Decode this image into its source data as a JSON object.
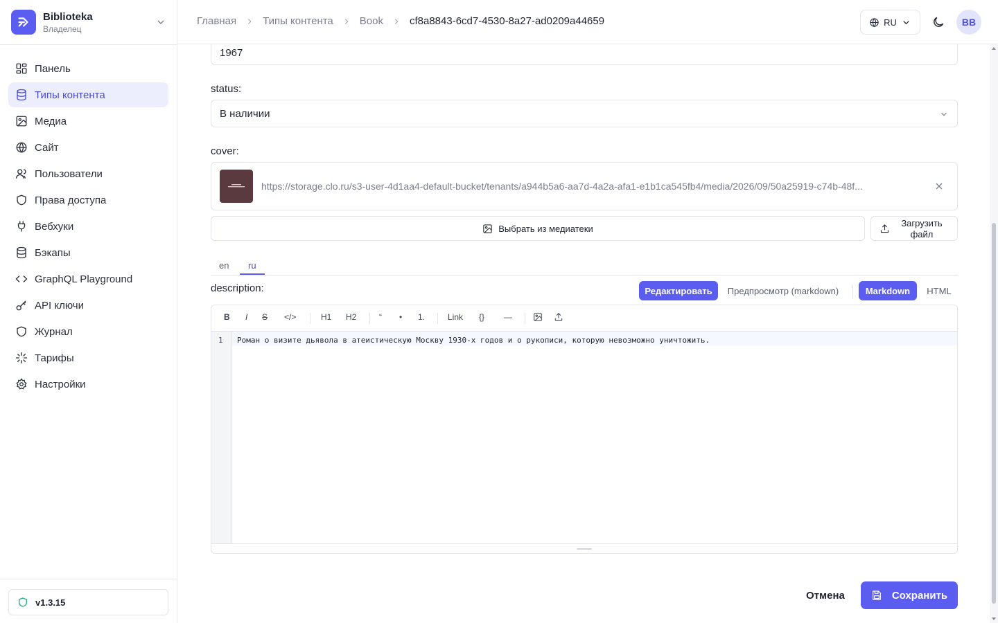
{
  "workspace": {
    "name": "Biblioteka",
    "role": "Владелец"
  },
  "nav": [
    {
      "label": "Панель",
      "icon": "dashboard-icon"
    },
    {
      "label": "Типы контента",
      "icon": "database-icon",
      "active": true
    },
    {
      "label": "Медиа",
      "icon": "image-icon"
    },
    {
      "label": "Сайт",
      "icon": "globe-icon"
    },
    {
      "label": "Пользователи",
      "icon": "users-icon"
    },
    {
      "label": "Права доступа",
      "icon": "shield-icon"
    },
    {
      "label": "Вебхуки",
      "icon": "plug-icon"
    },
    {
      "label": "Бэкапы",
      "icon": "database-icon"
    },
    {
      "label": "GraphQL Playground",
      "icon": "code-icon"
    },
    {
      "label": "API ключи",
      "icon": "key-icon"
    },
    {
      "label": "Журнал",
      "icon": "shield-icon"
    },
    {
      "label": "Тарифы",
      "icon": "sparkle-icon"
    },
    {
      "label": "Настройки",
      "icon": "gear-icon"
    }
  ],
  "version": "v1.3.15",
  "breadcrumbs": [
    "Главная",
    "Типы контента",
    "Book",
    "cf8a8843-6cd7-4530-8a27-ad0209a44659"
  ],
  "header": {
    "language": "RU",
    "avatar": "BB"
  },
  "form": {
    "year_value": "1967",
    "status_label": "status:",
    "status_value": "В наличии",
    "cover_label": "cover:",
    "cover_url": "https://storage.clo.ru/s3-user-4d1aa4-default-bucket/tenants/a944b5a6-aa7d-4a2a-afa1-e1b1ca545fb4/media/2026/09/50a25919-c74b-48f...",
    "choose_media": "Выбрать из медиатеки",
    "upload_file": "Загрузить файл",
    "locale_tabs": [
      "en",
      "ru"
    ],
    "active_locale": "ru",
    "description_label": "description:",
    "mode_edit": "Редактировать",
    "mode_preview": "Предпросмотр (markdown)",
    "format_markdown": "Markdown",
    "format_html": "HTML",
    "toolbar": [
      "B",
      "I",
      "S",
      "</>",
      "H1",
      "H2",
      "“",
      "•",
      "1.",
      "Link",
      "{}",
      "—"
    ],
    "line_number": "1",
    "content": "Роман о визите дьявола в атеистическую Москву 1930-х годов и о рукописи, которую невозможно уничтожить.",
    "cancel": "Отмена",
    "save": "Сохранить"
  },
  "colors": {
    "accent": "#5b5cf0",
    "active_nav_bg": "#eceefe",
    "cover_thumb": "#5a3a3e"
  }
}
